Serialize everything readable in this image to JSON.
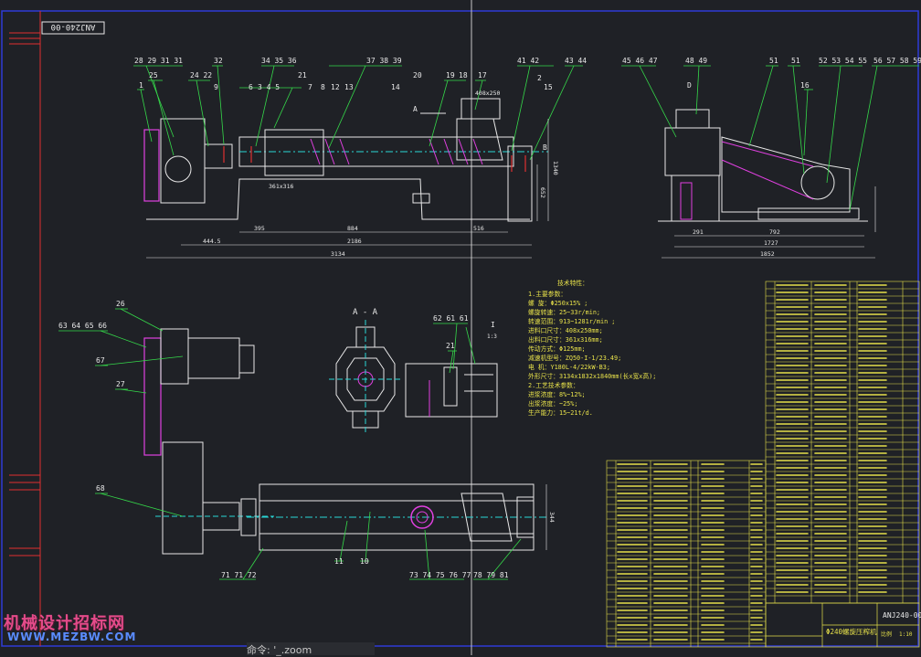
{
  "drawing": {
    "code_tag": "ANJ240-00",
    "balloons_main": [
      "28 29 31 31",
      "25",
      "24 22",
      "32",
      "34 35 36",
      "21",
      "37 38 39",
      "20",
      "19",
      "18",
      "17",
      "41 42",
      "43 44",
      "1",
      "9",
      "6",
      "3 4 5",
      "7",
      "8",
      "12",
      "13",
      "14",
      "15",
      "2",
      "A",
      "B"
    ],
    "balloons_side": [
      "45 46 47",
      "48 49",
      "51",
      "51",
      "52 53 54 55",
      "56 57 58 59",
      "16",
      "D"
    ],
    "balloons_plan": [
      "26",
      "63 64 65 66",
      "67",
      "27",
      "68",
      "11",
      "10",
      "71 71 72",
      "73 74 75 76 77",
      "78 79 81"
    ],
    "balloons_detail": [
      "62 61 61",
      "21",
      "I",
      "1:3"
    ],
    "section_label": "A - A",
    "dims_main": [
      "444.5",
      "395",
      "884",
      "2186",
      "516",
      "3134",
      "361x316",
      "408x250",
      "1340",
      "652"
    ],
    "dims_side": [
      "291",
      "792",
      "1727",
      "1852"
    ],
    "dims_plan": [
      "344"
    ]
  },
  "notes": {
    "title": "技术特性：",
    "lines": [
      "1.主要参数：",
      "  螺    旋：Φ250x15%  ;",
      "  螺旋转速：25~33r/min;",
      "  转速范围：913~1281r/min ;",
      "  进料口尺寸：408x250mm;",
      "  出料口尺寸：361x316mm;",
      "  传动方式：Φ125mm;",
      "  减速机型号：ZQ50-I-1/23.49;",
      "  电 机：Y180L-4/22kW-B3;",
      "  外形尺寸：3134x1832x1840mm(长x宽x高);",
      "2.工艺技术参数：",
      "  进浆浓度：8%~12%;",
      "  出浆浓度：~25%;",
      "  生产能力：15~21t/d."
    ]
  },
  "title_block": {
    "drawing_no": "ANJ240-00",
    "name": "Φ240螺旋压榨机",
    "scale_label": "比例",
    "scale": "1:10"
  },
  "cmdline": "命令: '_.zoom",
  "watermark": {
    "cn": "机械设计招标网",
    "url": "WWW.MEZBW.COM"
  },
  "colors": {
    "background": "#1f2126",
    "frame": "#2f3bd6",
    "green": "#35d94a",
    "white": "#e8e8e8",
    "yellow": "#e6e04a",
    "cyan": "#2ad6d6",
    "magenta": "#e040e0",
    "red": "#e03030"
  }
}
